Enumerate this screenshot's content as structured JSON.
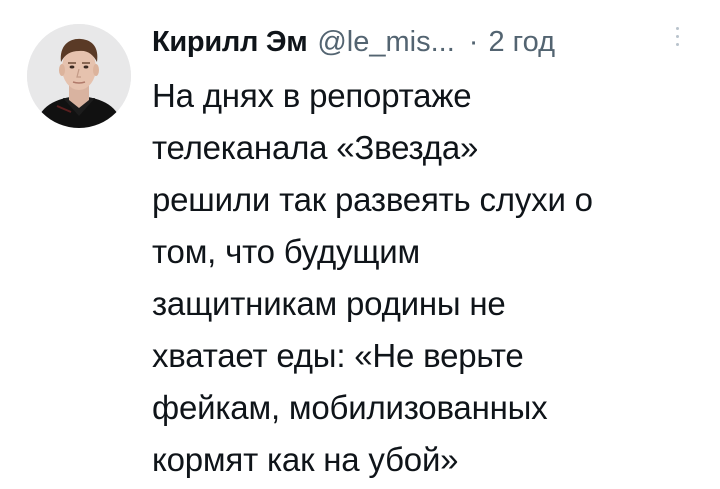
{
  "tweet": {
    "author_name": "Кирилл Эм",
    "handle": "@le_mis...",
    "separator": "·",
    "time": "2 год",
    "more_icon": "ellipsis-vertical-icon",
    "avatar_icon": "avatar",
    "text_lines": [
      "На днях в репортаже",
      "телеканала «Звезда»",
      "решили так развеять слухи о",
      "том, что будущим",
      "защитникам родины не",
      "хватает еды: «Не верьте",
      "фейкам, мобилизованных",
      "кормят как на убой»"
    ]
  },
  "colors": {
    "text": "#0f1419",
    "secondary": "#536471",
    "background": "#ffffff"
  }
}
